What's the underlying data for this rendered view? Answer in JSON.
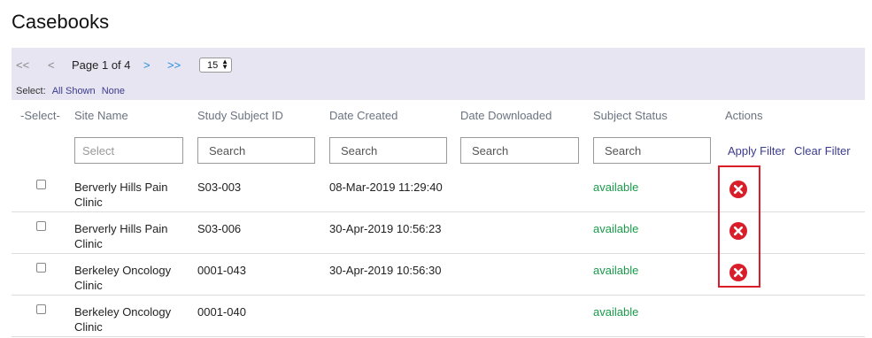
{
  "page": {
    "title": "Casebooks"
  },
  "pager": {
    "first": "<<",
    "prev": "<",
    "label": "Page 1 of 4",
    "next": ">",
    "last": ">>",
    "page_size": "15"
  },
  "select": {
    "label": "Select:",
    "all_shown": "All Shown",
    "none": "None"
  },
  "columns": {
    "select": "-Select-",
    "site_name": "Site Name",
    "study_subject_id": "Study Subject ID",
    "date_created": "Date Created",
    "date_downloaded": "Date Downloaded",
    "subject_status": "Subject Status",
    "actions": "Actions"
  },
  "filters": {
    "site_name": "Select",
    "study_subject_id": "Search",
    "date_created": "Search",
    "date_downloaded": "Search",
    "subject_status": "Search"
  },
  "filter_actions": {
    "apply": "Apply Filter",
    "clear": "Clear Filter"
  },
  "rows": [
    {
      "site_name": "Berverly Hills Pain Clinic",
      "subject_id": "S03-003",
      "date_created": "08-Mar-2019 11:29:40",
      "date_downloaded": "",
      "status": "available",
      "has_remove": true
    },
    {
      "site_name": "Berverly Hills Pain Clinic",
      "subject_id": "S03-006",
      "date_created": "30-Apr-2019 10:56:23",
      "date_downloaded": "",
      "status": "available",
      "has_remove": true
    },
    {
      "site_name": "Berkeley Oncology Clinic",
      "subject_id": "0001-043",
      "date_created": "30-Apr-2019 10:56:30",
      "date_downloaded": "",
      "status": "available",
      "has_remove": true
    },
    {
      "site_name": "Berkeley Oncology Clinic",
      "subject_id": "0001-040",
      "date_created": "",
      "date_downloaded": "",
      "status": "available",
      "has_remove": false
    }
  ],
  "icons": {
    "remove": "remove-circle-x-icon"
  },
  "colors": {
    "status_available": "#1a9a4a",
    "remove_icon": "#d91e2a",
    "highlight_border": "#d91e2a",
    "toolbar_bg": "#e7e5f1",
    "link": "#3b3b8f",
    "pager_active": "#2a8fe0"
  }
}
